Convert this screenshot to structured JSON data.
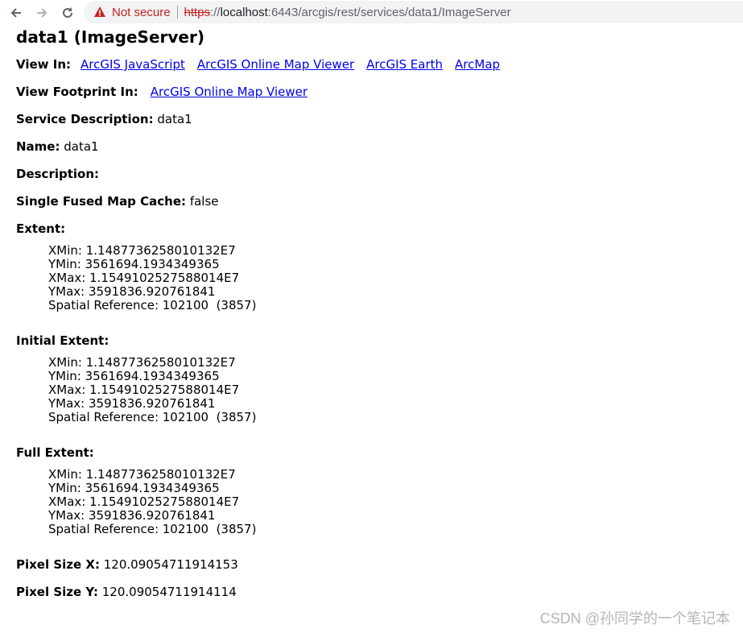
{
  "browser": {
    "not_secure": "Not secure",
    "url_scheme": "https",
    "url_sep": "://",
    "url_host": "localhost",
    "url_rest": ":6443/arcgis/rest/services/data1/ImageServer"
  },
  "page": {
    "title": "data1 (ImageServer)",
    "view_in": {
      "label": "View In:",
      "links": [
        "ArcGIS JavaScript",
        "ArcGIS Online Map Viewer",
        "ArcGIS Earth",
        "ArcMap"
      ]
    },
    "view_footprint": {
      "label": "View Footprint In:",
      "link": "ArcGIS Online Map Viewer"
    },
    "service_description": {
      "label": "Service Description:",
      "value": "data1"
    },
    "name": {
      "label": "Name:",
      "value": "data1"
    },
    "description": {
      "label": "Description:",
      "value": ""
    },
    "single_fused": {
      "label": "Single Fused Map Cache:",
      "value": "false"
    },
    "extent": {
      "label": "Extent:",
      "xmin": "XMin: 1.1487736258010132E7",
      "ymin": "YMin: 3561694.1934349365",
      "xmax": "XMax: 1.1549102527588014E7",
      "ymax": "YMax: 3591836.920761841",
      "sr": "Spatial Reference: 102100  (3857)"
    },
    "initial_extent": {
      "label": "Initial Extent:",
      "xmin": "XMin: 1.1487736258010132E7",
      "ymin": "YMin: 3561694.1934349365",
      "xmax": "XMax: 1.1549102527588014E7",
      "ymax": "YMax: 3591836.920761841",
      "sr": "Spatial Reference: 102100  (3857)"
    },
    "full_extent": {
      "label": "Full Extent:",
      "xmin": "XMin: 1.1487736258010132E7",
      "ymin": "YMin: 3561694.1934349365",
      "xmax": "XMax: 1.1549102527588014E7",
      "ymax": "YMax: 3591836.920761841",
      "sr": "Spatial Reference: 102100  (3857)"
    },
    "pixel_size_x": {
      "label": "Pixel Size X:",
      "value": "120.09054711914153"
    },
    "pixel_size_y": {
      "label": "Pixel Size Y:",
      "value": "120.09054711914114"
    }
  },
  "watermark": "CSDN @孙同学的一个笔记本",
  "icons": {
    "back": "back-arrow-icon",
    "forward": "forward-arrow-icon",
    "reload": "reload-icon",
    "warning": "warning-triangle-icon"
  }
}
